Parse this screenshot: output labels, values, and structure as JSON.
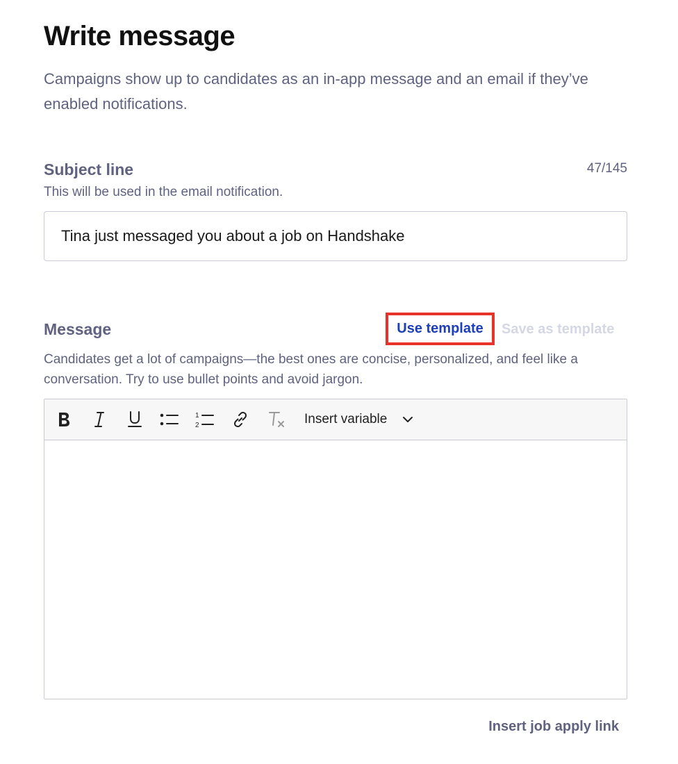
{
  "page": {
    "title": "Write message",
    "description": "Campaigns show up to candidates as an in-app message and an email if they’ve enabled notifications."
  },
  "subject": {
    "label": "Subject line",
    "char_count": "47/145",
    "help": "This will be used in the email notification.",
    "value": "Tina just messaged you about a job on Handshake"
  },
  "message": {
    "label": "Message",
    "use_template_label": "Use template",
    "save_template_label": "Save as template",
    "help": "Candidates get a lot of campaigns—the best ones are concise, personalized, and feel like a conversation. Try to use bullet points and avoid jargon.",
    "body": ""
  },
  "toolbar": {
    "icons": [
      "bold-icon",
      "italic-icon",
      "underline-icon",
      "bulleted-list-icon",
      "numbered-list-icon",
      "link-icon",
      "clear-formatting-icon"
    ],
    "insert_variable_label": "Insert variable"
  },
  "footer": {
    "insert_job_link_label": "Insert job apply link"
  },
  "colors": {
    "heading": "#111111",
    "muted_text": "#5f6380",
    "link_blue": "#1d3fb8",
    "highlight_red": "#e8332a",
    "disabled_text": "#d4d7e4",
    "border": "#c9ccd6",
    "toolbar_bg": "#f7f7f8"
  }
}
